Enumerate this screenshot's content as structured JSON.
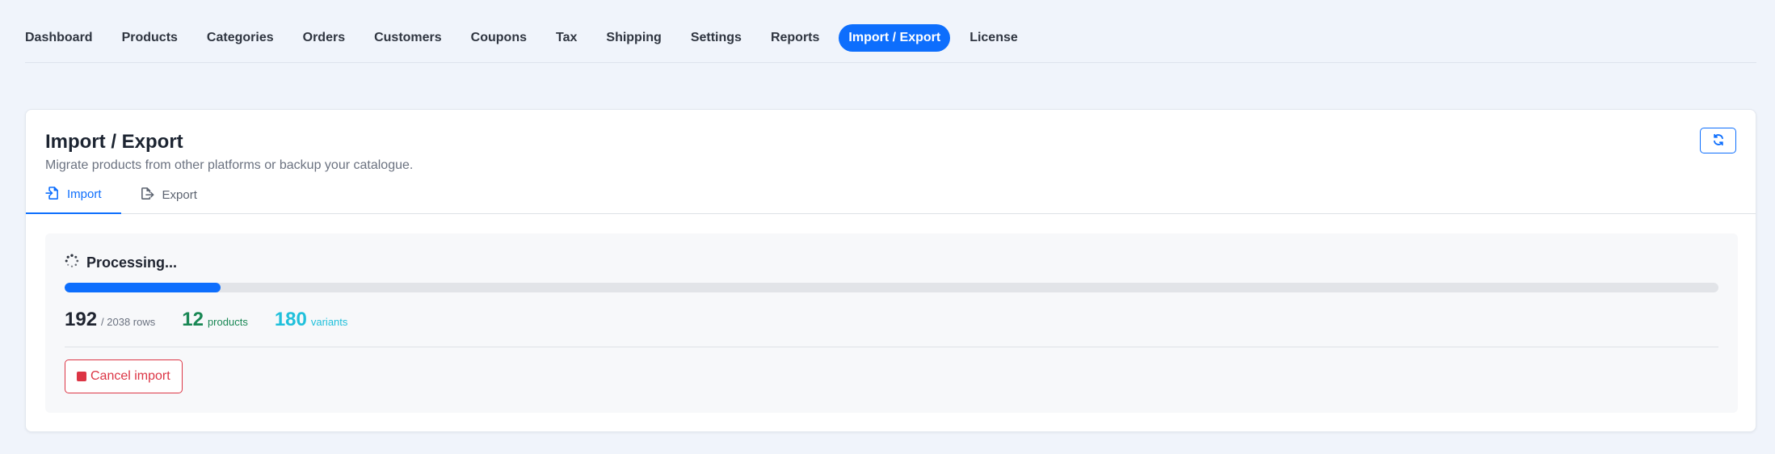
{
  "nav": {
    "items": [
      {
        "label": "Dashboard"
      },
      {
        "label": "Products"
      },
      {
        "label": "Categories"
      },
      {
        "label": "Orders"
      },
      {
        "label": "Customers"
      },
      {
        "label": "Coupons"
      },
      {
        "label": "Tax"
      },
      {
        "label": "Shipping"
      },
      {
        "label": "Settings"
      },
      {
        "label": "Reports"
      },
      {
        "label": "Import / Export",
        "active": true
      },
      {
        "label": "License"
      }
    ]
  },
  "header": {
    "title": "Import / Export",
    "subtitle": "Migrate products from other platforms or backup your catalogue.",
    "refresh_icon": "refresh-icon"
  },
  "tabs": [
    {
      "label": "Import",
      "icon": "file-import-icon",
      "active": true
    },
    {
      "label": "Export",
      "icon": "file-export-icon",
      "active": false
    }
  ],
  "progress": {
    "title": "Processing...",
    "processed": "192",
    "total_label": "/ 2038 rows",
    "fraction": 0.0942,
    "products_count": "12",
    "products_label": "products",
    "variants_count": "180",
    "variants_label": "variants",
    "cancel_label": "Cancel import"
  },
  "colors": {
    "accent": "#0d6efd",
    "success": "#198754",
    "info": "#20c0db",
    "danger": "#dc3545"
  }
}
